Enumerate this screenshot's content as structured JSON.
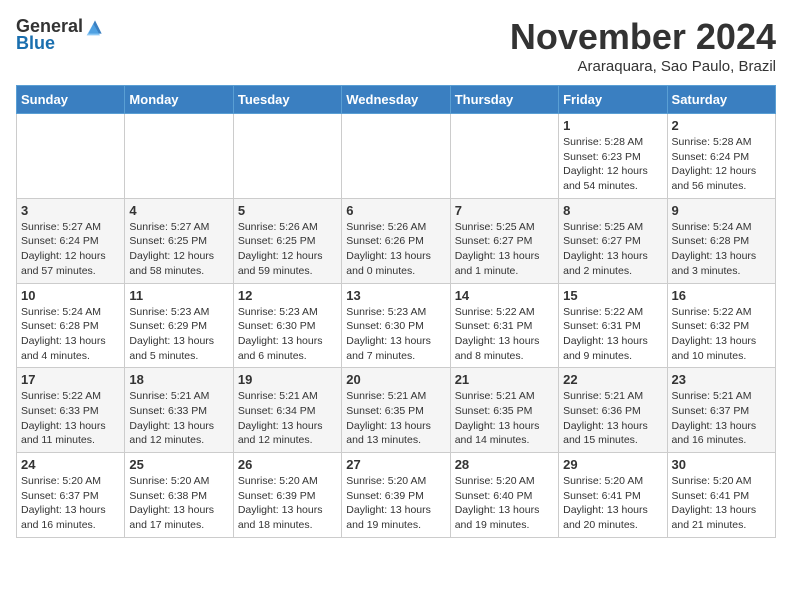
{
  "header": {
    "logo_general": "General",
    "logo_blue": "Blue",
    "month_title": "November 2024",
    "location": "Araraquara, Sao Paulo, Brazil"
  },
  "weekdays": [
    "Sunday",
    "Monday",
    "Tuesday",
    "Wednesday",
    "Thursday",
    "Friday",
    "Saturday"
  ],
  "weeks": [
    [
      {
        "day": "",
        "detail": ""
      },
      {
        "day": "",
        "detail": ""
      },
      {
        "day": "",
        "detail": ""
      },
      {
        "day": "",
        "detail": ""
      },
      {
        "day": "",
        "detail": ""
      },
      {
        "day": "1",
        "detail": "Sunrise: 5:28 AM\nSunset: 6:23 PM\nDaylight: 12 hours\nand 54 minutes."
      },
      {
        "day": "2",
        "detail": "Sunrise: 5:28 AM\nSunset: 6:24 PM\nDaylight: 12 hours\nand 56 minutes."
      }
    ],
    [
      {
        "day": "3",
        "detail": "Sunrise: 5:27 AM\nSunset: 6:24 PM\nDaylight: 12 hours\nand 57 minutes."
      },
      {
        "day": "4",
        "detail": "Sunrise: 5:27 AM\nSunset: 6:25 PM\nDaylight: 12 hours\nand 58 minutes."
      },
      {
        "day": "5",
        "detail": "Sunrise: 5:26 AM\nSunset: 6:25 PM\nDaylight: 12 hours\nand 59 minutes."
      },
      {
        "day": "6",
        "detail": "Sunrise: 5:26 AM\nSunset: 6:26 PM\nDaylight: 13 hours\nand 0 minutes."
      },
      {
        "day": "7",
        "detail": "Sunrise: 5:25 AM\nSunset: 6:27 PM\nDaylight: 13 hours\nand 1 minute."
      },
      {
        "day": "8",
        "detail": "Sunrise: 5:25 AM\nSunset: 6:27 PM\nDaylight: 13 hours\nand 2 minutes."
      },
      {
        "day": "9",
        "detail": "Sunrise: 5:24 AM\nSunset: 6:28 PM\nDaylight: 13 hours\nand 3 minutes."
      }
    ],
    [
      {
        "day": "10",
        "detail": "Sunrise: 5:24 AM\nSunset: 6:28 PM\nDaylight: 13 hours\nand 4 minutes."
      },
      {
        "day": "11",
        "detail": "Sunrise: 5:23 AM\nSunset: 6:29 PM\nDaylight: 13 hours\nand 5 minutes."
      },
      {
        "day": "12",
        "detail": "Sunrise: 5:23 AM\nSunset: 6:30 PM\nDaylight: 13 hours\nand 6 minutes."
      },
      {
        "day": "13",
        "detail": "Sunrise: 5:23 AM\nSunset: 6:30 PM\nDaylight: 13 hours\nand 7 minutes."
      },
      {
        "day": "14",
        "detail": "Sunrise: 5:22 AM\nSunset: 6:31 PM\nDaylight: 13 hours\nand 8 minutes."
      },
      {
        "day": "15",
        "detail": "Sunrise: 5:22 AM\nSunset: 6:31 PM\nDaylight: 13 hours\nand 9 minutes."
      },
      {
        "day": "16",
        "detail": "Sunrise: 5:22 AM\nSunset: 6:32 PM\nDaylight: 13 hours\nand 10 minutes."
      }
    ],
    [
      {
        "day": "17",
        "detail": "Sunrise: 5:22 AM\nSunset: 6:33 PM\nDaylight: 13 hours\nand 11 minutes."
      },
      {
        "day": "18",
        "detail": "Sunrise: 5:21 AM\nSunset: 6:33 PM\nDaylight: 13 hours\nand 12 minutes."
      },
      {
        "day": "19",
        "detail": "Sunrise: 5:21 AM\nSunset: 6:34 PM\nDaylight: 13 hours\nand 12 minutes."
      },
      {
        "day": "20",
        "detail": "Sunrise: 5:21 AM\nSunset: 6:35 PM\nDaylight: 13 hours\nand 13 minutes."
      },
      {
        "day": "21",
        "detail": "Sunrise: 5:21 AM\nSunset: 6:35 PM\nDaylight: 13 hours\nand 14 minutes."
      },
      {
        "day": "22",
        "detail": "Sunrise: 5:21 AM\nSunset: 6:36 PM\nDaylight: 13 hours\nand 15 minutes."
      },
      {
        "day": "23",
        "detail": "Sunrise: 5:21 AM\nSunset: 6:37 PM\nDaylight: 13 hours\nand 16 minutes."
      }
    ],
    [
      {
        "day": "24",
        "detail": "Sunrise: 5:20 AM\nSunset: 6:37 PM\nDaylight: 13 hours\nand 16 minutes."
      },
      {
        "day": "25",
        "detail": "Sunrise: 5:20 AM\nSunset: 6:38 PM\nDaylight: 13 hours\nand 17 minutes."
      },
      {
        "day": "26",
        "detail": "Sunrise: 5:20 AM\nSunset: 6:39 PM\nDaylight: 13 hours\nand 18 minutes."
      },
      {
        "day": "27",
        "detail": "Sunrise: 5:20 AM\nSunset: 6:39 PM\nDaylight: 13 hours\nand 19 minutes."
      },
      {
        "day": "28",
        "detail": "Sunrise: 5:20 AM\nSunset: 6:40 PM\nDaylight: 13 hours\nand 19 minutes."
      },
      {
        "day": "29",
        "detail": "Sunrise: 5:20 AM\nSunset: 6:41 PM\nDaylight: 13 hours\nand 20 minutes."
      },
      {
        "day": "30",
        "detail": "Sunrise: 5:20 AM\nSunset: 6:41 PM\nDaylight: 13 hours\nand 21 minutes."
      }
    ]
  ]
}
